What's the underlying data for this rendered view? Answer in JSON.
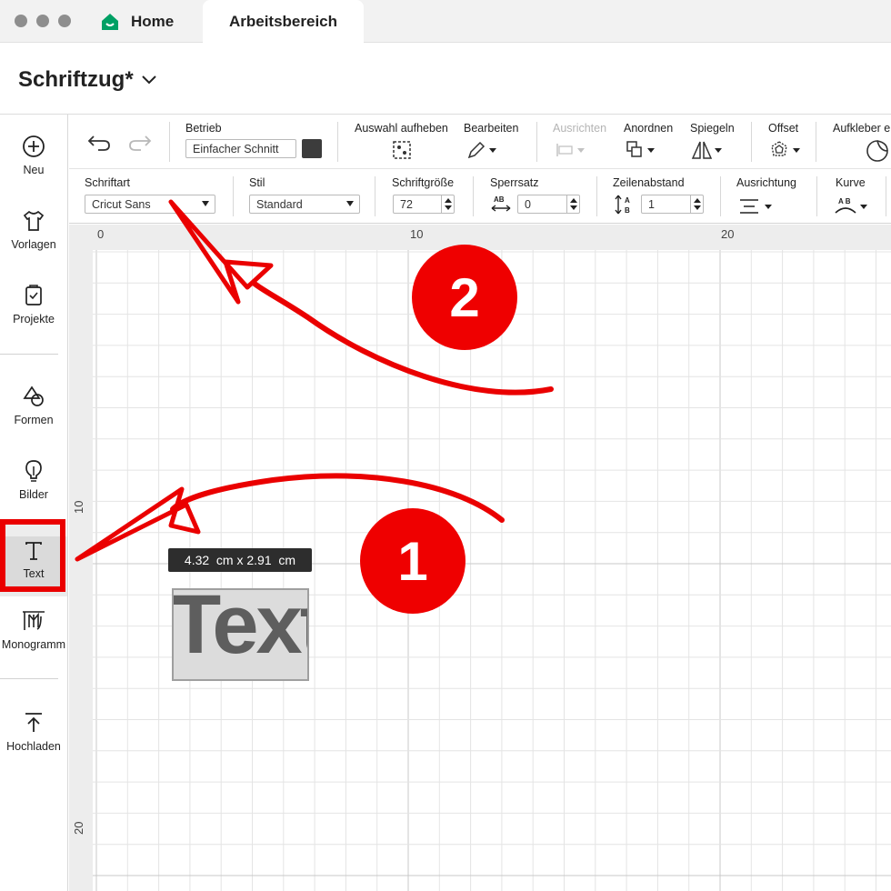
{
  "window": {
    "tabs": [
      {
        "label": "Home",
        "icon": "cricut-home-icon",
        "color": "#00a064"
      },
      {
        "label": "Arbeitsbereich"
      }
    ]
  },
  "project": {
    "title": "Schriftzug*"
  },
  "sidebar": {
    "items": [
      {
        "label": "Neu",
        "icon": "plus-circle-icon"
      },
      {
        "label": "Vorlagen",
        "icon": "tshirt-icon"
      },
      {
        "label": "Projekte",
        "icon": "project-icon"
      },
      {
        "label": "Formen",
        "icon": "shapes-icon"
      },
      {
        "label": "Bilder",
        "icon": "lightbulb-icon"
      },
      {
        "label": "Text",
        "icon": "text-t-icon"
      },
      {
        "label": "Monogramm",
        "icon": "monogram-icon"
      },
      {
        "label": "Hochladen",
        "icon": "upload-icon"
      }
    ]
  },
  "toolbar1": {
    "betrieb_label": "Betrieb",
    "betrieb_value": "Einfacher Schnitt",
    "auswahl_label": "Auswahl aufheben",
    "bearbeiten_label": "Bearbeiten",
    "ausrichten_label": "Ausrichten",
    "anordnen_label": "Anordnen",
    "spiegeln_label": "Spiegeln",
    "offset_label": "Offset",
    "aufkleber_label": "Aufkleber e",
    "swatch_color": "#3c3c3c"
  },
  "toolbar2": {
    "schriftart_label": "Schriftart",
    "schriftart_value": "Cricut Sans",
    "stil_label": "Stil",
    "stil_value": "Standard",
    "schriftgroesse_label": "Schriftgröße",
    "schriftgroesse_value": "72",
    "sperrsatz_label": "Sperrsatz",
    "sperrsatz_value": "0",
    "zeilenabstand_label": "Zeilenabstand",
    "zeilenabstand_value": "1",
    "ausrichtung_label": "Ausrichtung",
    "kurve_label": "Kurve"
  },
  "canvas": {
    "ruler_top": [
      "0",
      "10",
      "20"
    ],
    "ruler_left": [
      "10",
      "20"
    ],
    "dimensions": "4.32  cm x 2.91  cm",
    "text_object": "Text"
  },
  "annotations": {
    "badge1": "1",
    "badge2": "2",
    "color": "#ea0000"
  }
}
